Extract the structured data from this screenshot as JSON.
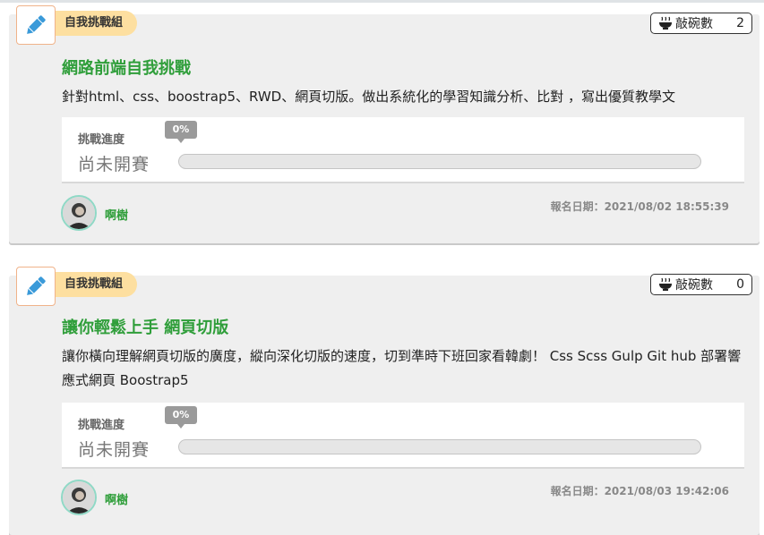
{
  "cards": [
    {
      "category": "自我挑戰組",
      "bowl_label": "敲碗數",
      "bowl_count": "2",
      "title": "網路前端自我挑戰",
      "description": "針對html、css、boostrap5、RWD、網頁切版。做出系統化的學習知識分析、比對 ，寫出優質教學文",
      "progress_label": "挑戰進度",
      "progress_value": "0%",
      "status": "尚未開賽",
      "author": "啊樹",
      "signup_date": "報名日期：2021/08/02 18:55:39"
    },
    {
      "category": "自我挑戰組",
      "bowl_label": "敲碗數",
      "bowl_count": "0",
      "title": "讓你輕鬆上手 網頁切版",
      "description": "讓你橫向理解網頁切版的廣度，縱向深化切版的速度，切到準時下班回家看韓劇！ Css Scss Gulp Git hub 部署響應式網頁 Boostrap5",
      "progress_label": "挑戰進度",
      "progress_value": "0%",
      "status": "尚未開賽",
      "author": "啊樹",
      "signup_date": "報名日期：2021/08/03 19:42:06"
    }
  ],
  "icons": {
    "category": "pencil-icon",
    "bowl": "bowl-icon",
    "avatar": "avatar-photo"
  },
  "colors": {
    "accent_green": "#2f9e3a",
    "category_pill": "#fddfa0",
    "pencil_blue": "#3a9ad9"
  }
}
